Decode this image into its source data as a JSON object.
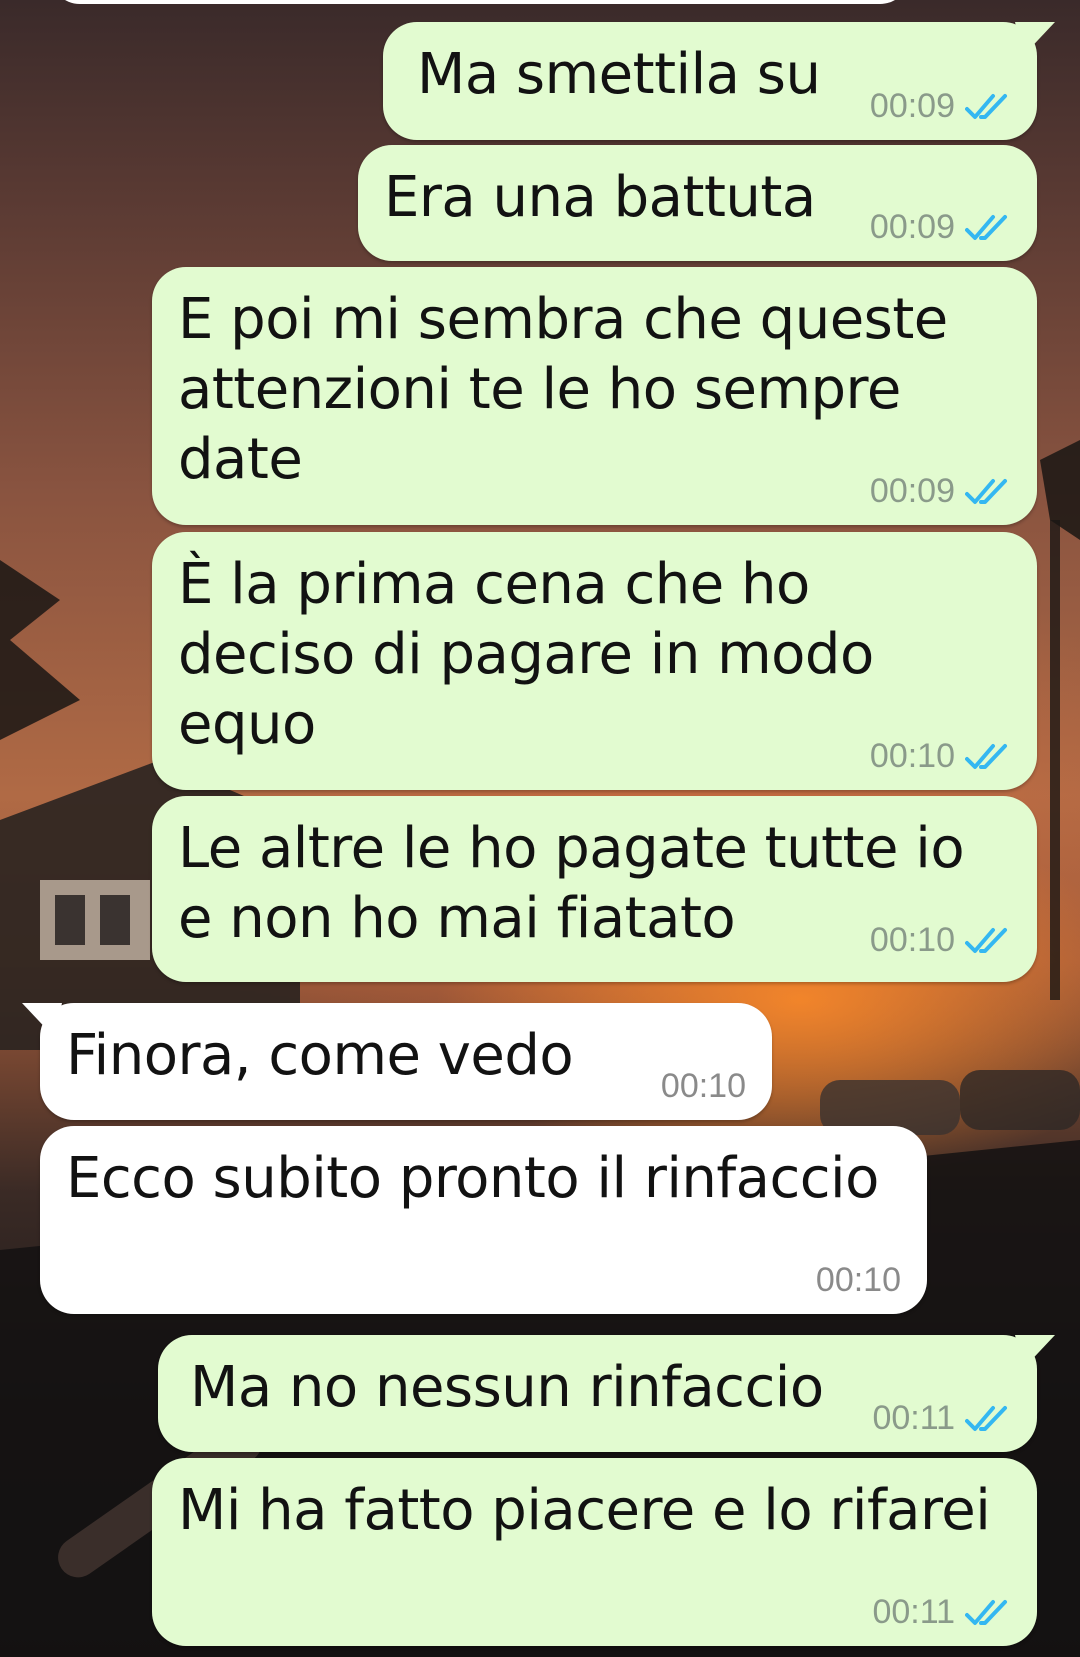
{
  "messages": [
    {
      "text": "Ma smettila su",
      "time": "00:09",
      "dir": "out"
    },
    {
      "text": "Era una battuta",
      "time": "00:09",
      "dir": "out"
    },
    {
      "text": "E poi mi sembra che queste attenzioni te le ho sempre date",
      "time": "00:09",
      "dir": "out"
    },
    {
      "text": "È la prima cena che ho deciso di pagare in modo equo",
      "time": "00:10",
      "dir": "out"
    },
    {
      "text": "Le altre le ho pagate tutte io e non ho mai fiatato",
      "time": "00:10",
      "dir": "out"
    },
    {
      "text": "Finora, come vedo",
      "time": "00:10",
      "dir": "in"
    },
    {
      "text": "Ecco subito pronto il rinfaccio",
      "time": "00:10",
      "dir": "in"
    },
    {
      "text": "Ma no nessun rinfaccio",
      "time": "00:11",
      "dir": "out"
    },
    {
      "text": "Mi ha fatto piacere e lo rifarei",
      "time": "00:11",
      "dir": "out"
    }
  ],
  "colors": {
    "outgoing_bubble": "#e2fbd0",
    "incoming_bubble": "#ffffff",
    "read_ticks": "#34b7f1",
    "timestamp": "#8a9a8a"
  },
  "icons": {
    "read_receipt": "double-check-icon"
  }
}
